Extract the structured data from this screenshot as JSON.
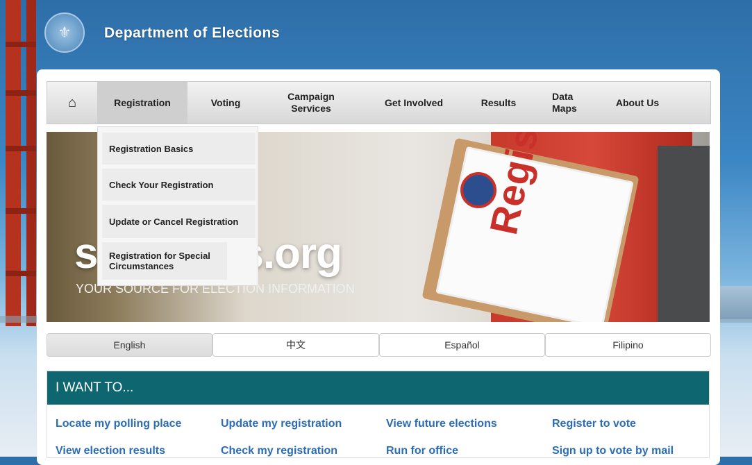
{
  "header": {
    "title": "Department of Elections",
    "seal_icon": "city-seal-icon"
  },
  "nav": {
    "home_icon": "home-icon",
    "items": [
      {
        "label": "Registration",
        "active": true
      },
      {
        "label": "Voting"
      },
      {
        "label": "Campaign Services"
      },
      {
        "label": "Get Involved"
      },
      {
        "label": "Results"
      },
      {
        "label": "Data Maps"
      },
      {
        "label": "About Us"
      }
    ]
  },
  "dropdown": {
    "items": [
      "Registration Basics",
      "Check Your Registration",
      "Update or Cancel Registration",
      "Registration for Special Circumstances"
    ]
  },
  "hero": {
    "site_text_left": "s",
    "site_text_right": "ns.org",
    "tagline": "YOUR SOURCE FOR ELECTION INFORMATION",
    "sign_text": "Register to VOTE Here"
  },
  "languages": {
    "items": [
      "English",
      "中文",
      "Español",
      "Filipino"
    ],
    "active": "English"
  },
  "want": {
    "heading": "I WANT TO...",
    "row1": [
      "Locate my polling place",
      "Update my registration",
      "View future elections",
      "Register to vote"
    ],
    "row2": [
      "View election results",
      "Check my registration",
      "Run for office",
      "Sign up to vote by mail"
    ]
  },
  "colors": {
    "accent_teal": "#0e6671",
    "link_blue": "#2b6cb3",
    "sign_red": "#c9302a"
  }
}
